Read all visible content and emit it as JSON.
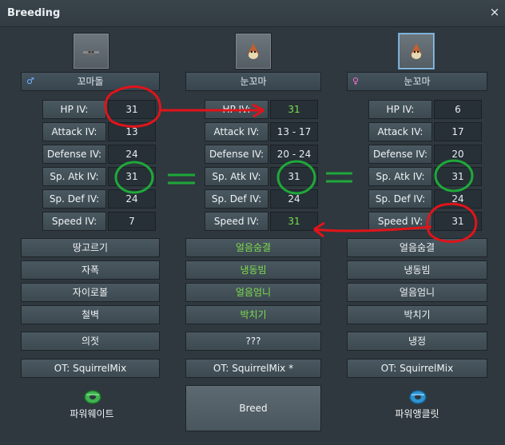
{
  "window": {
    "title": "Breeding",
    "close_icon": "×"
  },
  "parent_left": {
    "name": "꼬마돌",
    "gender_symbol": "♂",
    "stats": [
      {
        "label": "HP IV:",
        "value": "31"
      },
      {
        "label": "Attack IV:",
        "value": "13"
      },
      {
        "label": "Defense IV:",
        "value": "24"
      },
      {
        "label": "Sp. Atk IV:",
        "value": "31"
      },
      {
        "label": "Sp. Def IV:",
        "value": "24"
      },
      {
        "label": "Speed IV:",
        "value": "7"
      }
    ],
    "moves": [
      "땅고르기",
      "자폭",
      "자이로볼",
      "철벽",
      "의젓"
    ],
    "ot": "OT: SquirrelMix",
    "held_item": "파워웨이트"
  },
  "offspring": {
    "name": "눈꼬마",
    "stats": [
      {
        "label": "HP IV:",
        "value": "31"
      },
      {
        "label": "Attack IV:",
        "value": "13 - 17"
      },
      {
        "label": "Defense IV:",
        "value": "20 - 24"
      },
      {
        "label": "Sp. Atk IV:",
        "value": "31"
      },
      {
        "label": "Sp. Def IV:",
        "value": "24"
      },
      {
        "label": "Speed IV:",
        "value": "31"
      }
    ],
    "moves": [
      "얼음숨결",
      "냉동빔",
      "얼음엄니",
      "박치기",
      "???"
    ],
    "ot": "OT: SquirrelMix *",
    "breed_label": "Breed"
  },
  "parent_right": {
    "name": "눈꼬마",
    "gender_symbol": "♀",
    "stats": [
      {
        "label": "HP IV:",
        "value": "6"
      },
      {
        "label": "Attack IV:",
        "value": "17"
      },
      {
        "label": "Defense IV:",
        "value": "20"
      },
      {
        "label": "Sp. Atk IV:",
        "value": "31"
      },
      {
        "label": "Sp. Def IV:",
        "value": "24"
      },
      {
        "label": "Speed IV:",
        "value": "31"
      }
    ],
    "moves": [
      "얼음숨결",
      "냉동빔",
      "얼음엄니",
      "박치기",
      "냉정"
    ],
    "ot": "OT: SquirrelMix",
    "held_item": "파워앵클릿"
  },
  "colors": {
    "inherited_green": "#7dde4c",
    "annotation_red": "#e0141a",
    "annotation_green": "#1fa83a"
  }
}
